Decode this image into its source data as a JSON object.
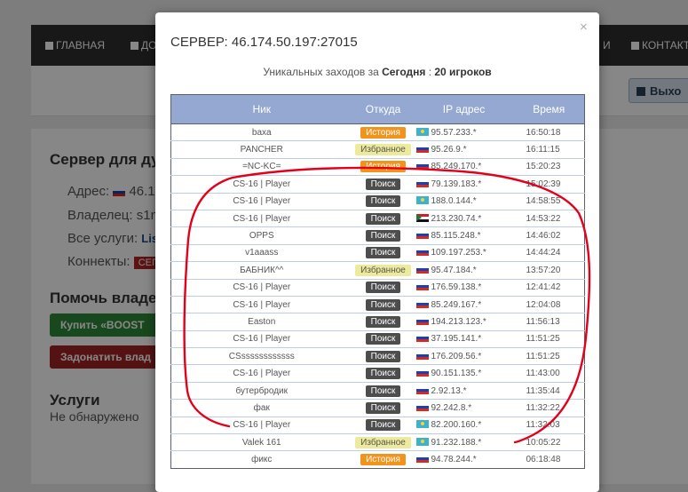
{
  "background_page": {
    "nav": [
      {
        "label": "ГЛАВНАЯ",
        "icon": "home-icon"
      },
      {
        "label": "ДО",
        "icon": "plus-square-icon"
      },
      {
        "label": "И",
        "icon": ""
      },
      {
        "label": "КОНТАКТ",
        "icon": "envelope-icon"
      }
    ],
    "exit_label": "Выхо",
    "server_heading": "Сервер для ду",
    "address_label": "Адрес:",
    "address_value": "46.17",
    "owner_label": "Владелец:",
    "owner_value": "s1ng",
    "services_label": "Все услуги:",
    "services_link": "Lists",
    "connects_label": "Коннекты:",
    "connects_badge": "СЕГО",
    "help_heading": "Помочь владе",
    "boost_button": "Купить «BOOST",
    "donate_button": "Задонатить влад",
    "uslugi_heading": "Услуги",
    "uslugi_status": "Не обнаружено"
  },
  "modal": {
    "title": "СЕРВЕР: 46.174.50.197:27015",
    "close_glyph": "×",
    "subtitle_prefix": "Уникальных заходов за ",
    "subtitle_period": "Сегодня",
    "subtitle_sep": " : ",
    "subtitle_count": "20 игроков",
    "columns": [
      "Ник",
      "Откуда",
      "IP адрес",
      "Время"
    ],
    "rows": [
      {
        "nick": "baxa",
        "source": "История",
        "source_type": "history",
        "flag": "kz",
        "ip": "95.57.233.*",
        "time": "16:50:18"
      },
      {
        "nick": "PANCHER",
        "source": "Избранное",
        "source_type": "fav",
        "flag": "ru",
        "ip": "95.26.9.*",
        "time": "16:11:15"
      },
      {
        "nick": "=NC-KC=",
        "source": "История",
        "source_type": "history",
        "flag": "ru",
        "ip": "85.249.170.*",
        "time": "15:20:23"
      },
      {
        "nick": "CS-16 | Player",
        "source": "Поиск",
        "source_type": "search",
        "flag": "ru",
        "ip": "79.139.183.*",
        "time": "15:02:39"
      },
      {
        "nick": "CS-16 | Player",
        "source": "Поиск",
        "source_type": "search",
        "flag": "kz",
        "ip": "188.0.144.*",
        "time": "14:58:55"
      },
      {
        "nick": "CS-16 | Player",
        "source": "Поиск",
        "source_type": "search",
        "flag": "sd",
        "ip": "213.230.74.*",
        "time": "14:53:22"
      },
      {
        "nick": "OPPS",
        "source": "Поиск",
        "source_type": "search",
        "flag": "ru",
        "ip": "85.115.248.*",
        "time": "14:46:02"
      },
      {
        "nick": "v1aaass",
        "source": "Поиск",
        "source_type": "search",
        "flag": "ru",
        "ip": "109.197.253.*",
        "time": "14:44:24"
      },
      {
        "nick": "БАБНИК^^",
        "source": "Избранное",
        "source_type": "fav",
        "flag": "ru",
        "ip": "95.47.184.*",
        "time": "13:57:20"
      },
      {
        "nick": "CS-16 | Player",
        "source": "Поиск",
        "source_type": "search",
        "flag": "ru",
        "ip": "176.59.138.*",
        "time": "12:41:42"
      },
      {
        "nick": "CS-16 | Player",
        "source": "Поиск",
        "source_type": "search",
        "flag": "ru",
        "ip": "85.249.167.*",
        "time": "12:04:08"
      },
      {
        "nick": "Easton",
        "source": "Поиск",
        "source_type": "search",
        "flag": "ru",
        "ip": "194.213.123.*",
        "time": "11:56:13"
      },
      {
        "nick": "CS-16 | Player",
        "source": "Поиск",
        "source_type": "search",
        "flag": "ru",
        "ip": "37.195.141.*",
        "time": "11:51:25"
      },
      {
        "nick": "CSssssssssssss",
        "source": "Поиск",
        "source_type": "search",
        "flag": "ru",
        "ip": "176.209.56.*",
        "time": "11:51:25"
      },
      {
        "nick": "CS-16 | Player",
        "source": "Поиск",
        "source_type": "search",
        "flag": "ru",
        "ip": "90.151.135.*",
        "time": "11:43:00"
      },
      {
        "nick": "бутербродик",
        "source": "Поиск",
        "source_type": "search",
        "flag": "ru",
        "ip": "2.92.13.*",
        "time": "11:35:44"
      },
      {
        "nick": "фак",
        "source": "Поиск",
        "source_type": "search",
        "flag": "ru",
        "ip": "92.242.8.*",
        "time": "11:32:22"
      },
      {
        "nick": "CS-16 | Player",
        "source": "Поиск",
        "source_type": "search",
        "flag": "kz",
        "ip": "82.200.160.*",
        "time": "11:32:03"
      },
      {
        "nick": "Valek 161",
        "source": "Избранное",
        "source_type": "fav",
        "flag": "kz",
        "ip": "91.232.188.*",
        "time": "10:05:22"
      },
      {
        "nick": "фикс",
        "source": "История",
        "source_type": "history",
        "flag": "ru",
        "ip": "94.78.244.*",
        "time": "06:18:48"
      }
    ]
  },
  "colors": {
    "header_bg": "#95a8d2",
    "history_badge": "#f2931c",
    "favorite_badge": "#edea9c",
    "search_badge": "#4d4d4d",
    "annotation_stroke": "#e3001b"
  }
}
